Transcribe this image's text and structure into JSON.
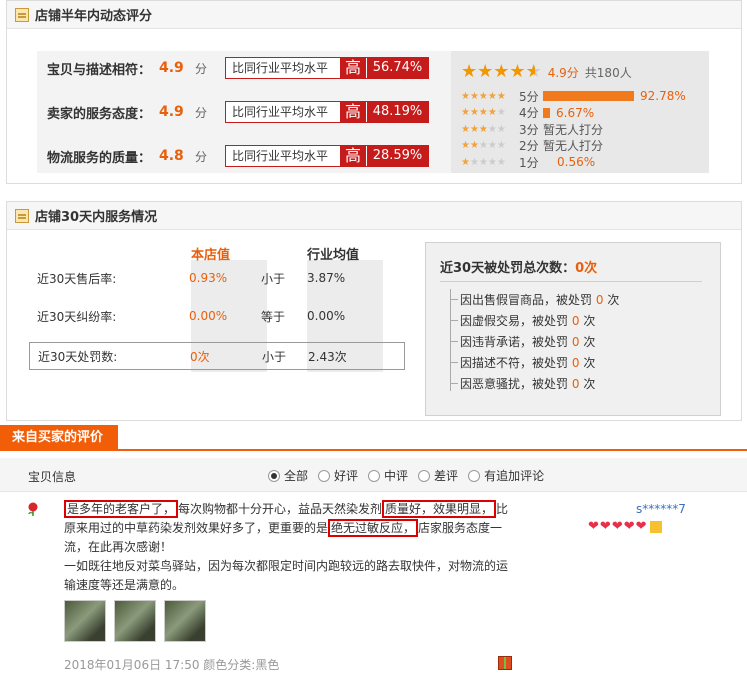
{
  "dsr": {
    "title": "店铺半年内动态评分",
    "rows": [
      {
        "label": "宝贝与描述相符：",
        "score": "4.9",
        "unit": "分",
        "compare": "比同行业平均水平",
        "level": "高",
        "pct": "56.74%"
      },
      {
        "label": "卖家的服务态度：",
        "score": "4.9",
        "unit": "分",
        "compare": "比同行业平均水平",
        "level": "高",
        "pct": "48.19%"
      },
      {
        "label": "物流服务的质量：",
        "score": "4.8",
        "unit": "分",
        "compare": "比同行业平均水平",
        "level": "高",
        "pct": "28.59%"
      }
    ],
    "summary": {
      "score": "4.9分",
      "count": "共180人",
      "stars": 4.5
    },
    "distribution": [
      {
        "label": "5分",
        "pct": "92.78%",
        "fraction": 0.9278,
        "stars": 5
      },
      {
        "label": "4分",
        "pct": "6.67%",
        "fraction": 0.0667,
        "stars": 4
      },
      {
        "label": "3分",
        "none": "暂无人打分",
        "fraction": 0,
        "stars": 3
      },
      {
        "label": "2分",
        "none": "暂无人打分",
        "fraction": 0,
        "stars": 2
      },
      {
        "label": "1分",
        "pct": "0.56%",
        "fraction": 0.0056,
        "stars": 1
      }
    ]
  },
  "service": {
    "title": "店铺30天内服务情况",
    "col_mine": "本店值",
    "col_avg": "行业均值",
    "rows": [
      {
        "label": "近30天售后率:",
        "mine": "0.93%",
        "rel": "小于",
        "avg": "3.87%"
      },
      {
        "label": "近30天纠纷率:",
        "mine": "0.00%",
        "rel": "等于",
        "avg": "0.00%"
      },
      {
        "label": "近30天处罚数:",
        "mine": "0次",
        "rel": "小于",
        "avg": "2.43次"
      }
    ],
    "penalty": {
      "title": "近30天被处罚总次数：",
      "total": "0次",
      "items": [
        {
          "text": "因出售假冒商品，被处罚",
          "count": "0",
          "unit": "次"
        },
        {
          "text": "因虚假交易，被处罚",
          "count": "0",
          "unit": "次"
        },
        {
          "text": "因违背承诺，被处罚",
          "count": "0",
          "unit": "次"
        },
        {
          "text": "因描述不符，被处罚",
          "count": "0",
          "unit": "次"
        },
        {
          "text": "因恶意骚扰，被处罚",
          "count": "0",
          "unit": "次"
        }
      ]
    }
  },
  "reviews": {
    "tab": "来自买家的评价",
    "filter_title": "宝贝信息",
    "filters": [
      "全部",
      "好评",
      "中评",
      "差评",
      "有追加评论"
    ],
    "selected_filter": "全部",
    "item": {
      "t1": "是多年的老客户了，",
      "t2": "每次购物都十分开心，益品天然染发剂",
      "t3": "质量好，效果明显，",
      "t4": "比原来用过的中草药染发剂效果好多了，更重要的是",
      "t5": "绝无过敏反应，",
      "t6": "店家服务态度一流，在此再次感谢！",
      "t7": "一如既往地反对菜鸟驿站，因为每次都限定时间内跑较远的路去取快件，对物流的运输速度等还是满意的。",
      "date": "2018年01月06日 17:50 颜色分类:黑色",
      "nick": "s******7",
      "hearts": 5
    }
  },
  "colors": {
    "accent": "#f25d08",
    "high": "#c61b1b",
    "score": "#e8600c",
    "star": "#f29700"
  }
}
